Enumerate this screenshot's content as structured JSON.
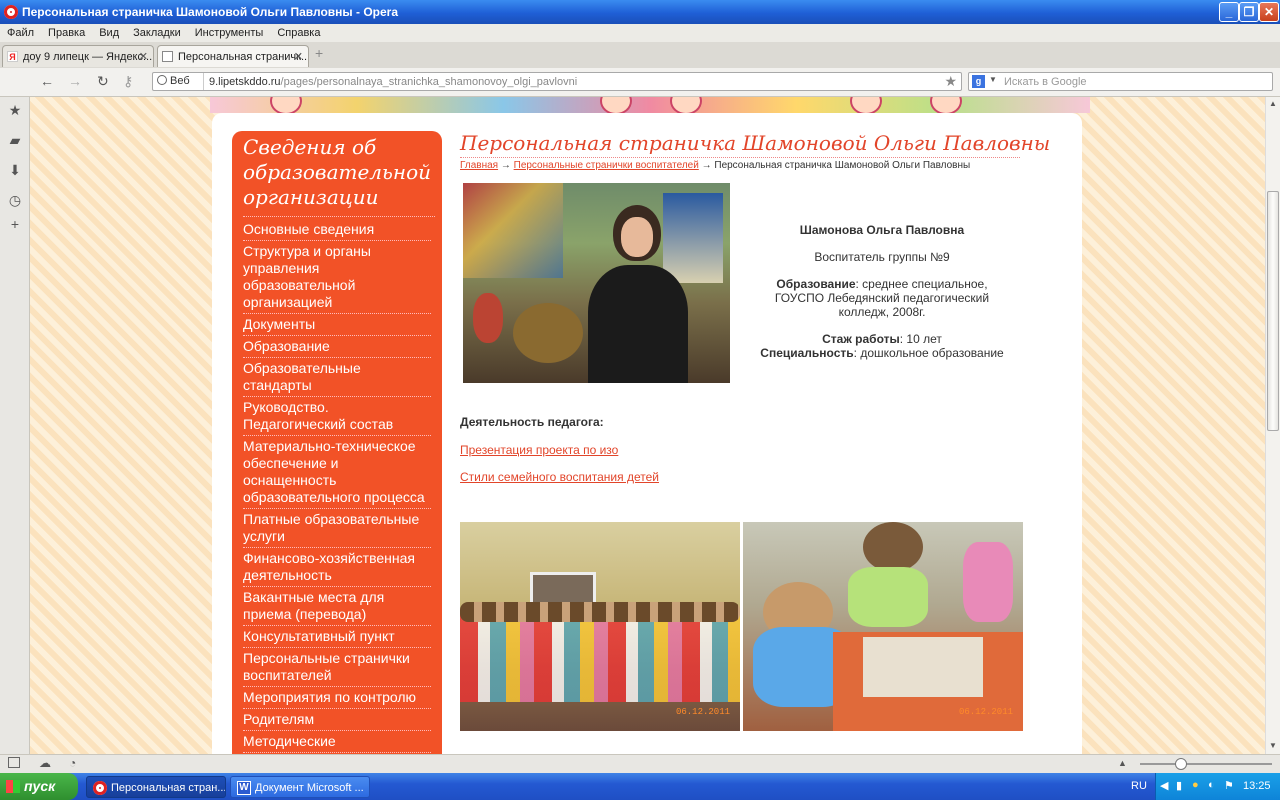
{
  "window": {
    "title": "Персональная страничка Шамоновой Ольги Павловны - Opera"
  },
  "menubar": [
    "Файл",
    "Правка",
    "Вид",
    "Закладки",
    "Инструменты",
    "Справка"
  ],
  "tabs": [
    {
      "label": "доу 9 липецк — Яндекс..."
    },
    {
      "label": "Персональная страничк..."
    }
  ],
  "address": {
    "mode": "Веб",
    "url_host": "9.lipetskddo.ru",
    "url_path": "/pages/personalnaya_stranichka_shamonovoy_olgi_pavlovni"
  },
  "search": {
    "placeholder": "Искать в Google"
  },
  "sidebar": {
    "heading": "Сведения об образовательной организации",
    "items": [
      "Основные сведения",
      "Структура и органы управления образовательной организацией",
      "Документы",
      "Образование",
      "Образовательные стандарты",
      "Руководство. Педагогический состав",
      "Материально-техническое обеспечение и оснащенность образовательного процесса",
      "Платные образовательные услуги",
      "Финансово-хозяйственная деятельность",
      "Вакантные места для приема (перевода)",
      "Консультативный пункт",
      "Персональные странички воспитателей",
      "Мероприятия по контролю",
      "Родителям",
      "Методические"
    ]
  },
  "page": {
    "title": "Персональная страничка Шамоновой Ольги Павловны",
    "breadcrumb": {
      "home": "Главная",
      "arrow": "→",
      "section": "Персональные странички воспитателей",
      "current": "Персональная страничка Шамоновой Ольги Павловны"
    },
    "profile": {
      "name": "Шамонова Ольга Павловна",
      "position": "Воспитатель группы №9",
      "education_label": "Образование",
      "education_value": ": среднее специальное, ГОУСПО Лебедянский педагогический колледж, 2008г.",
      "experience_label": "Стаж работы",
      "experience_value": ": 10 лет",
      "specialty_label": "Специальность",
      "specialty_value": ": дошкольное образование"
    },
    "activity_heading": "Деятельность педагога:",
    "links": [
      "Презентация проекта по изо",
      "Стили семейного воспитания детей"
    ],
    "photo_dates": [
      "06.12.2011",
      "06.12.2011"
    ]
  },
  "taskbar": {
    "start": "пуск",
    "tasks": [
      "Персональная стран...",
      "Документ Microsoft ..."
    ],
    "lang": "RU",
    "clock": "13:25"
  },
  "colors": {
    "accent": "#f25227",
    "title_red": "#e2452a"
  }
}
